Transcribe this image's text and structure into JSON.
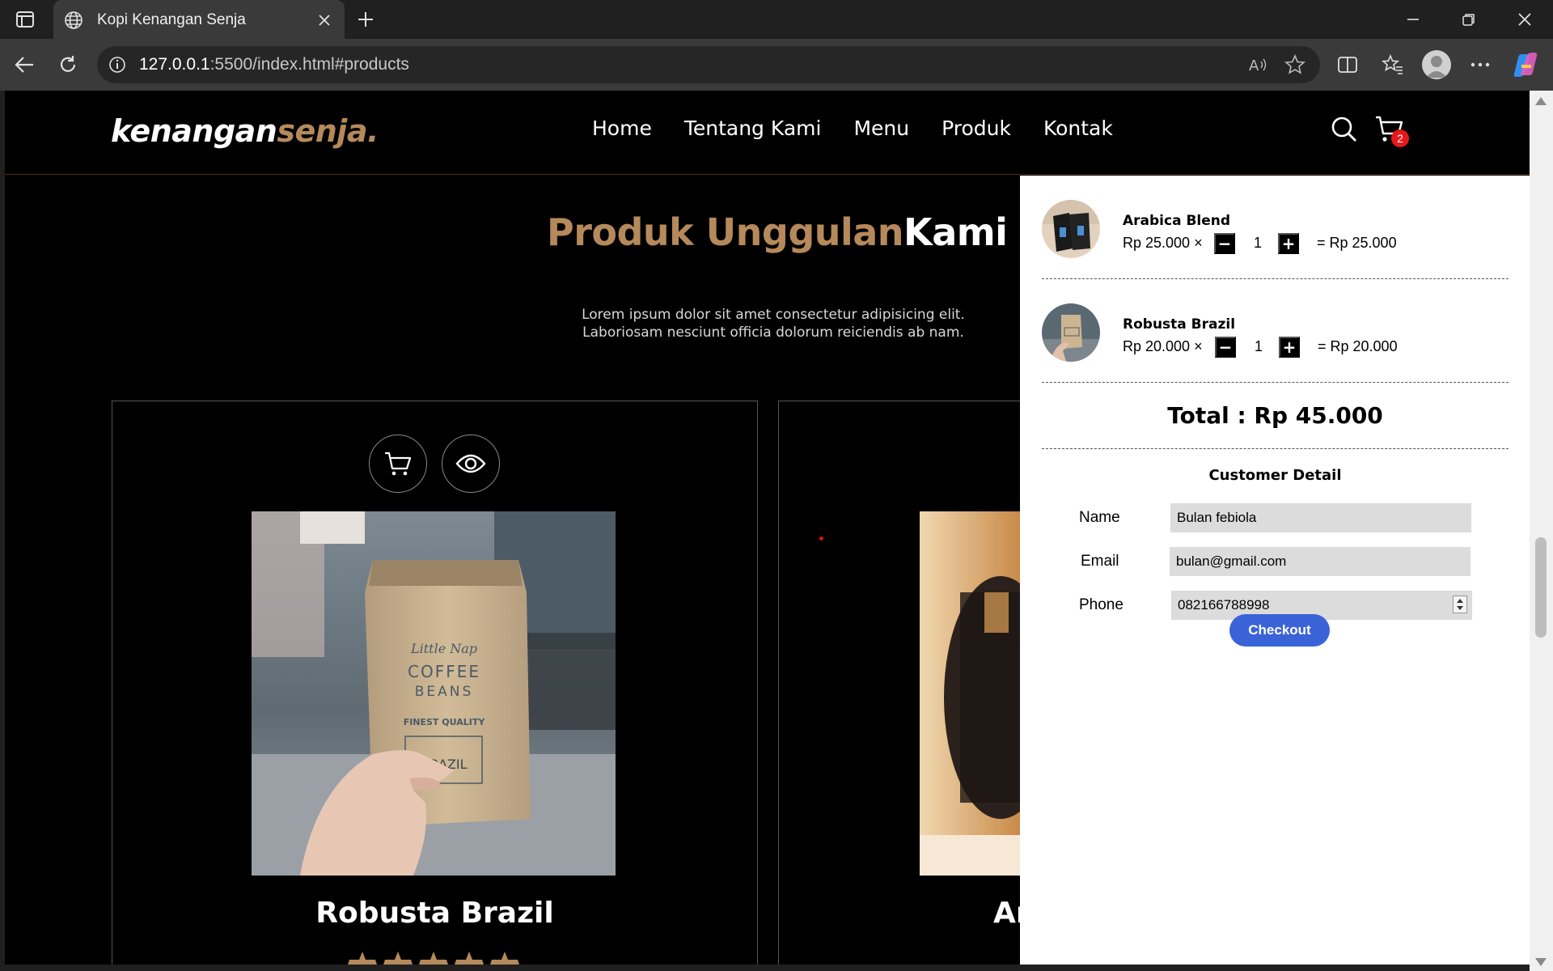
{
  "browser": {
    "tab_title": "Kopi Kenangan Senja",
    "url_host": "127.0.0.1",
    "url_rest": ":5500/index.html#products"
  },
  "site": {
    "logo_main": "kenangan",
    "logo_accent": "senja.",
    "nav": [
      "Home",
      "Tentang Kami",
      "Menu",
      "Produk",
      "Kontak"
    ],
    "cart_count": "2"
  },
  "products_section": {
    "title_accent": "Produk Unggulan",
    "title_white": "Kami",
    "desc_line1": "Lorem ipsum dolor sit amet consectetur adipisicing elit.",
    "desc_line2": "Laboriosam nesciunt officia dolorum reiciendis ab nam.",
    "card1_name": "Robusta Brazil",
    "card2_name_partial": "Ar",
    "bag_brand": "Little Nap",
    "bag_line1": "COFFEE",
    "bag_line2": "BEANS",
    "bag_quality": "FINEST QUALITY",
    "bag_origin": "BRAZIL"
  },
  "cart": {
    "items": [
      {
        "name": "Arabica Blend",
        "price": "Rp 25.000 ×",
        "qty": "1",
        "subtotal": "= Rp 25.000",
        "minus": "−",
        "plus": "+"
      },
      {
        "name": "Robusta Brazil",
        "price": "Rp 20.000 ×",
        "qty": "1",
        "subtotal": "= Rp 20.000",
        "minus": "−",
        "plus": "+"
      }
    ],
    "total": "Total : Rp 45.000",
    "customer_title": "Customer Detail",
    "name_label": "Name",
    "name_value": "Bulan febiola",
    "email_label": "Email",
    "email_value": "bulan@gmail.com",
    "phone_label": "Phone",
    "phone_value": "082166788998",
    "checkout_label": "Checkout"
  },
  "colors": {
    "accent": "#b6895b",
    "checkout": "#3b63d8",
    "badge": "#e8171b"
  }
}
